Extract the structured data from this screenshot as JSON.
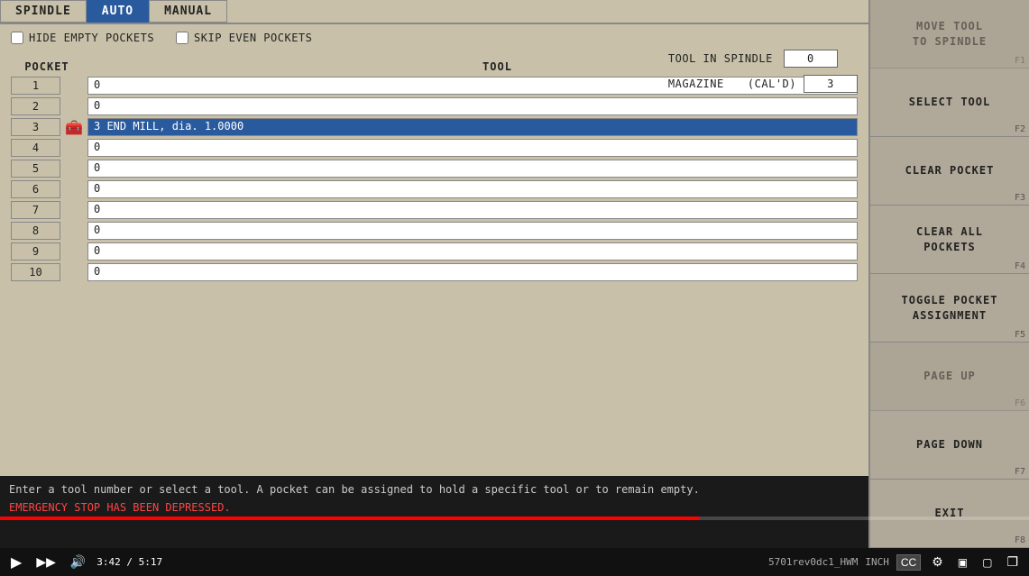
{
  "tabs": [
    {
      "label": "SPINDLE",
      "active": false
    },
    {
      "label": "AUTO",
      "active": true
    },
    {
      "label": "MANUAL",
      "active": false
    }
  ],
  "checkboxes": [
    {
      "label": "HIDE EMPTY POCKETS",
      "checked": false
    },
    {
      "label": "SKIP EVEN POCKETS",
      "checked": false
    }
  ],
  "info": {
    "tool_in_spindle_label": "TOOL IN SPINDLE",
    "tool_in_spindle_value": "0",
    "magazine_label": "MAGAZINE",
    "magazine_sub_label": "(CAL'D)",
    "magazine_value": "3"
  },
  "columns": {
    "pocket": "POCKET",
    "tool": "TOOL"
  },
  "pockets": [
    {
      "num": 1,
      "value": "0",
      "selected": false,
      "icon": false
    },
    {
      "num": 2,
      "value": "0",
      "selected": false,
      "icon": false
    },
    {
      "num": 3,
      "value": "3 END MILL, dia. 1.0000",
      "selected": true,
      "icon": true
    },
    {
      "num": 4,
      "value": "0",
      "selected": false,
      "icon": false
    },
    {
      "num": 5,
      "value": "0",
      "selected": false,
      "icon": false
    },
    {
      "num": 6,
      "value": "0",
      "selected": false,
      "icon": false
    },
    {
      "num": 7,
      "value": "0",
      "selected": false,
      "icon": false
    },
    {
      "num": 8,
      "value": "0",
      "selected": false,
      "icon": false
    },
    {
      "num": 9,
      "value": "0",
      "selected": false,
      "icon": false
    },
    {
      "num": 10,
      "value": "0",
      "selected": false,
      "icon": false
    }
  ],
  "fn_buttons": [
    {
      "label": "MOVE TOOL\nTO SPINDLE",
      "key": "F1",
      "disabled": true
    },
    {
      "label": "SELECT TOOL",
      "key": "F2",
      "disabled": false
    },
    {
      "label": "CLEAR POCKET",
      "key": "F3",
      "disabled": false
    },
    {
      "label": "CLEAR ALL\nPOCKETS",
      "key": "F4",
      "disabled": false
    },
    {
      "label": "TOGGLE POCKET\nASSIGNMENT",
      "key": "F5",
      "disabled": false
    },
    {
      "label": "PAGE UP",
      "key": "F6",
      "disabled": true
    },
    {
      "label": "PAGE DOWN",
      "key": "F7",
      "disabled": false
    },
    {
      "label": "EXIT",
      "key": "F8",
      "disabled": false
    }
  ],
  "bottom_text": {
    "info": "Enter a tool number or select a tool.  A pocket can be\nassigned to hold a specific tool or to remain empty.",
    "emergency": "EMERGENCY STOP HAS BEEN DEPRESSED."
  },
  "video_controls": {
    "time_current": "3:42",
    "time_total": "5:17",
    "progress_percent": 68
  },
  "status_bar": {
    "filename": "5701rev0dc1_HWM",
    "unit": "INCH"
  }
}
